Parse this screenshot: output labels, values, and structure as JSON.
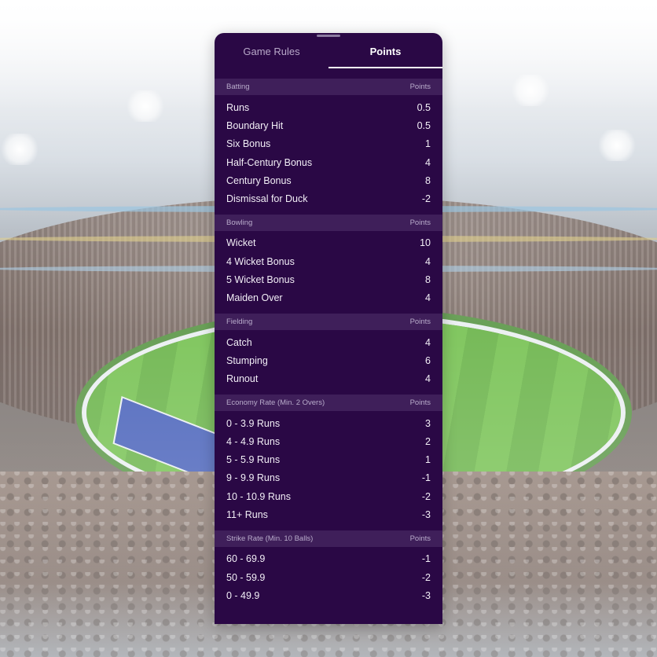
{
  "tabs": [
    {
      "label": "Game Rules",
      "active": false
    },
    {
      "label": "Points",
      "active": true
    }
  ],
  "sections": [
    {
      "title": "Batting",
      "points_label": "Points",
      "rows": [
        {
          "label": "Runs",
          "value": "0.5"
        },
        {
          "label": "Boundary Hit",
          "value": "0.5"
        },
        {
          "label": "Six Bonus",
          "value": "1"
        },
        {
          "label": "Half-Century Bonus",
          "value": "4"
        },
        {
          "label": "Century Bonus",
          "value": "8"
        },
        {
          "label": "Dismissal for Duck",
          "value": "-2"
        }
      ]
    },
    {
      "title": "Bowling",
      "points_label": "Points",
      "rows": [
        {
          "label": "Wicket",
          "value": "10"
        },
        {
          "label": "4 Wicket Bonus",
          "value": "4"
        },
        {
          "label": "5 Wicket Bonus",
          "value": "8"
        },
        {
          "label": "Maiden Over",
          "value": "4"
        }
      ]
    },
    {
      "title": "Fielding",
      "points_label": "Points",
      "rows": [
        {
          "label": "Catch",
          "value": "4"
        },
        {
          "label": "Stumping",
          "value": "6"
        },
        {
          "label": "Runout",
          "value": "4"
        }
      ]
    },
    {
      "title": "Economy Rate (Min. 2 Overs)",
      "points_label": "Points",
      "rows": [
        {
          "label": "0 - 3.9 Runs",
          "value": "3"
        },
        {
          "label": "4 - 4.9 Runs",
          "value": "2"
        },
        {
          "label": "5 - 5.9 Runs",
          "value": "1"
        },
        {
          "label": "9 - 9.9 Runs",
          "value": "-1"
        },
        {
          "label": "10 - 10.9 Runs",
          "value": "-2"
        },
        {
          "label": "11+ Runs",
          "value": "-3"
        }
      ]
    },
    {
      "title": "Strike Rate (Min. 10 Balls)",
      "points_label": "Points",
      "rows": [
        {
          "label": "60 -  69.9",
          "value": "-1"
        },
        {
          "label": "50 - 59.9",
          "value": "-2"
        },
        {
          "label": "0 - 49.9",
          "value": "-3"
        }
      ]
    }
  ],
  "colors": {
    "panel": "#2a0845",
    "section_header": "#3f1f5a",
    "active_tab": "#ffffff",
    "inactive_tab": "#b8a9c9"
  }
}
